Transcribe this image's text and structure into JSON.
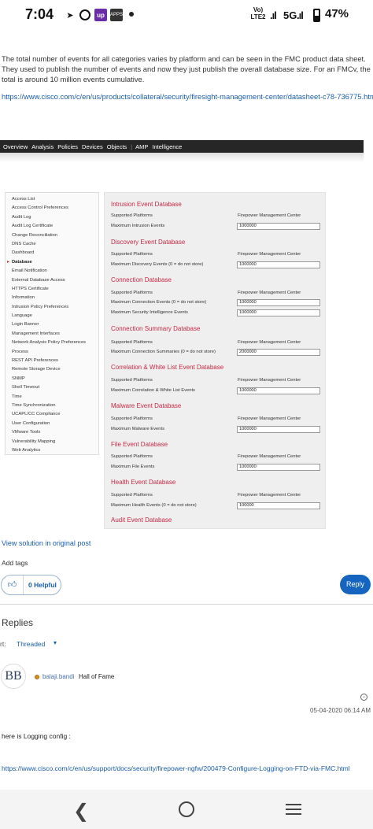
{
  "status_bar": {
    "time": "7:04",
    "volte": "Vo) LTE2",
    "network": "5G",
    "battery": "47%",
    "up_icon": "up",
    "box_icon": "APPS"
  },
  "post": {
    "intro_text": "The total number of events for all categories varies by platform and can be seen in the FMC product data sheet. They used to publish the number of events and now they just publish the overall database size. For an FMCv, the total is around 10 million events cumulative.",
    "datasheet_link": "https://www.cisco.com/c/en/us/products/collateral/security/firesight-management-center/datasheet-c78-736775.html"
  },
  "fmc": {
    "nav": [
      "Overview",
      "Analysis",
      "Policies",
      "Devices",
      "Objects",
      "AMP",
      "Intelligence"
    ],
    "menu": [
      "Access List",
      "Access Control Preferences",
      "Audit Log",
      "Audit Log Certificate",
      "Change Reconciliation",
      "DNS Cache",
      "Dashboard",
      "Database",
      "Email Notification",
      "External Database Access",
      "HTTPS Certificate",
      "Information",
      "Intrusion Policy Preferences",
      "Language",
      "Login Banner",
      "Management Interfaces",
      "Network Analysis Policy Preferences",
      "Process",
      "REST API Preferences",
      "Remote Storage Device",
      "SNMP",
      "Shell Timeout",
      "Time",
      "Time Synchronization",
      "UCAPL/CC Compliance",
      "User Configuration",
      "VMware Tools",
      "Vulnerability Mapping",
      "Web Analytics"
    ],
    "active_menu": "Database",
    "supported_platforms_label": "Supported Platforms",
    "supported_platforms_value": "Firepower Management Center",
    "sections": [
      {
        "title": "Intrusion Event Database",
        "rows": [
          {
            "label": "Maximum Intrusion Events",
            "value": "1000000"
          }
        ]
      },
      {
        "title": "Discovery Event Database",
        "rows": [
          {
            "label": "Maximum Discovery Events (0 = do not store)",
            "value": "1000000"
          }
        ]
      },
      {
        "title": "Connection Database",
        "rows": [
          {
            "label": "Maximum Connection Events (0 = do not store)",
            "value": "1000000"
          },
          {
            "label": "Maximum Security Intelligence Events",
            "value": "1000000"
          }
        ]
      },
      {
        "title": "Connection Summary Database",
        "rows": [
          {
            "label": "Maximum Connection Summaries (0 = do not store)",
            "value": "2000000"
          }
        ]
      },
      {
        "title": "Correlation & White List Event Database",
        "rows": [
          {
            "label": "Maximum Correlation & White List Events",
            "value": "1000000"
          }
        ]
      },
      {
        "title": "Malware Event Database",
        "rows": [
          {
            "label": "Maximum Malware Events",
            "value": "1000000"
          }
        ]
      },
      {
        "title": "File Event Database",
        "rows": [
          {
            "label": "Maximum File Events",
            "value": "1000000"
          }
        ]
      },
      {
        "title": "Health Event Database",
        "rows": [
          {
            "label": "Maximum Health Events (0 = do not store)",
            "value": "100000"
          }
        ]
      }
    ],
    "last_section_title": "Audit Event Database"
  },
  "actions": {
    "view_solution": "View solution in original post",
    "add_tags": "Add tags",
    "helpful_label": "0 Helpful",
    "reply_label": "Reply"
  },
  "replies": {
    "heading": "Replies",
    "sort_label": "rt:",
    "sort_value": "Threaded",
    "reply": {
      "avatar_initials": "BB",
      "username": "balaji.bandi",
      "rank": "Hall of Fame",
      "date": "05-04-2020 06:14 AM",
      "body": "here is Logging config :",
      "link": "https://www.cisco.com/c/en/us/support/docs/security/firepower-ngfw/200479-Configure-Logging-on-FTD-via-FMC.html"
    }
  },
  "colors": {
    "link": "#1a5ea8",
    "section_title": "#c62a45",
    "reply_button": "#1565c0",
    "fmc_nav": "#262626"
  }
}
